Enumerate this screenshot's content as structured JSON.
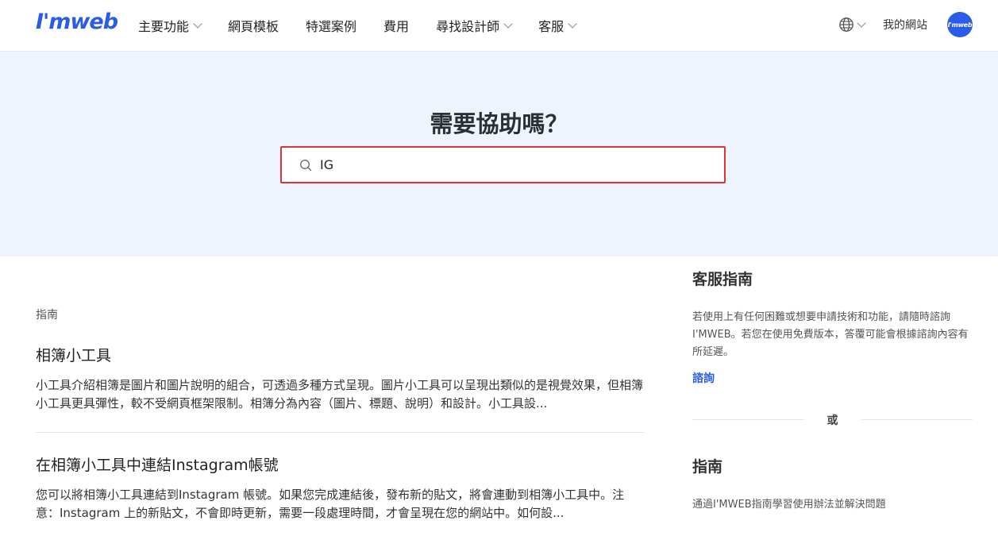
{
  "header": {
    "logo": "I'mweb",
    "nav": [
      {
        "label": "主要功能",
        "dropdown": true
      },
      {
        "label": "網頁模板",
        "dropdown": false
      },
      {
        "label": "特選案例",
        "dropdown": false
      },
      {
        "label": "費用",
        "dropdown": false
      },
      {
        "label": "尋找設計師",
        "dropdown": true
      },
      {
        "label": "客服",
        "dropdown": true
      }
    ],
    "my_site": "我的網站",
    "avatar_text": "I'mweb"
  },
  "hero": {
    "title": "需要協助嗎？",
    "search_value": "IG"
  },
  "results": {
    "section_label": "指南",
    "items": [
      {
        "title": "相簿小工具",
        "desc": "小工具介紹相簿是圖片和圖片說明的組合，可透過多種方式呈現。圖片小工具可以呈現出類似的是視覺效果，但相簿小工具更具彈性，較不受網頁框架限制。相簿分為內容（圖片、標題、說明）和設計。小工具設..."
      },
      {
        "title": "在相簿小工具中連結Instagram帳號",
        "desc": "您可以將相簿小工具連結到Instagram 帳號。如果您完成連結後，發布新的貼文，將會連動到相簿小工具中。注意：Instagram 上的新貼文，不會即時更新，需要一段處理時間，才會呈現在您的網站中。如何設..."
      }
    ]
  },
  "sidebar": {
    "support_title": "客服指南",
    "support_text": "若使用上有任何困難或想要申請技術和功能，請隨時諮詢I'MWEB。若您在使用免費版本，答覆可能會根據諮詢內容有所延遲。",
    "support_link": "諮詢",
    "or": "或",
    "guide_title": "指南",
    "guide_text": "通過I'MWEB指南學習使用辦法並解決問題"
  },
  "colors": {
    "brand": "#2b5ce8",
    "hero_bg": "#eef4fb",
    "highlight": "#e0323c"
  }
}
